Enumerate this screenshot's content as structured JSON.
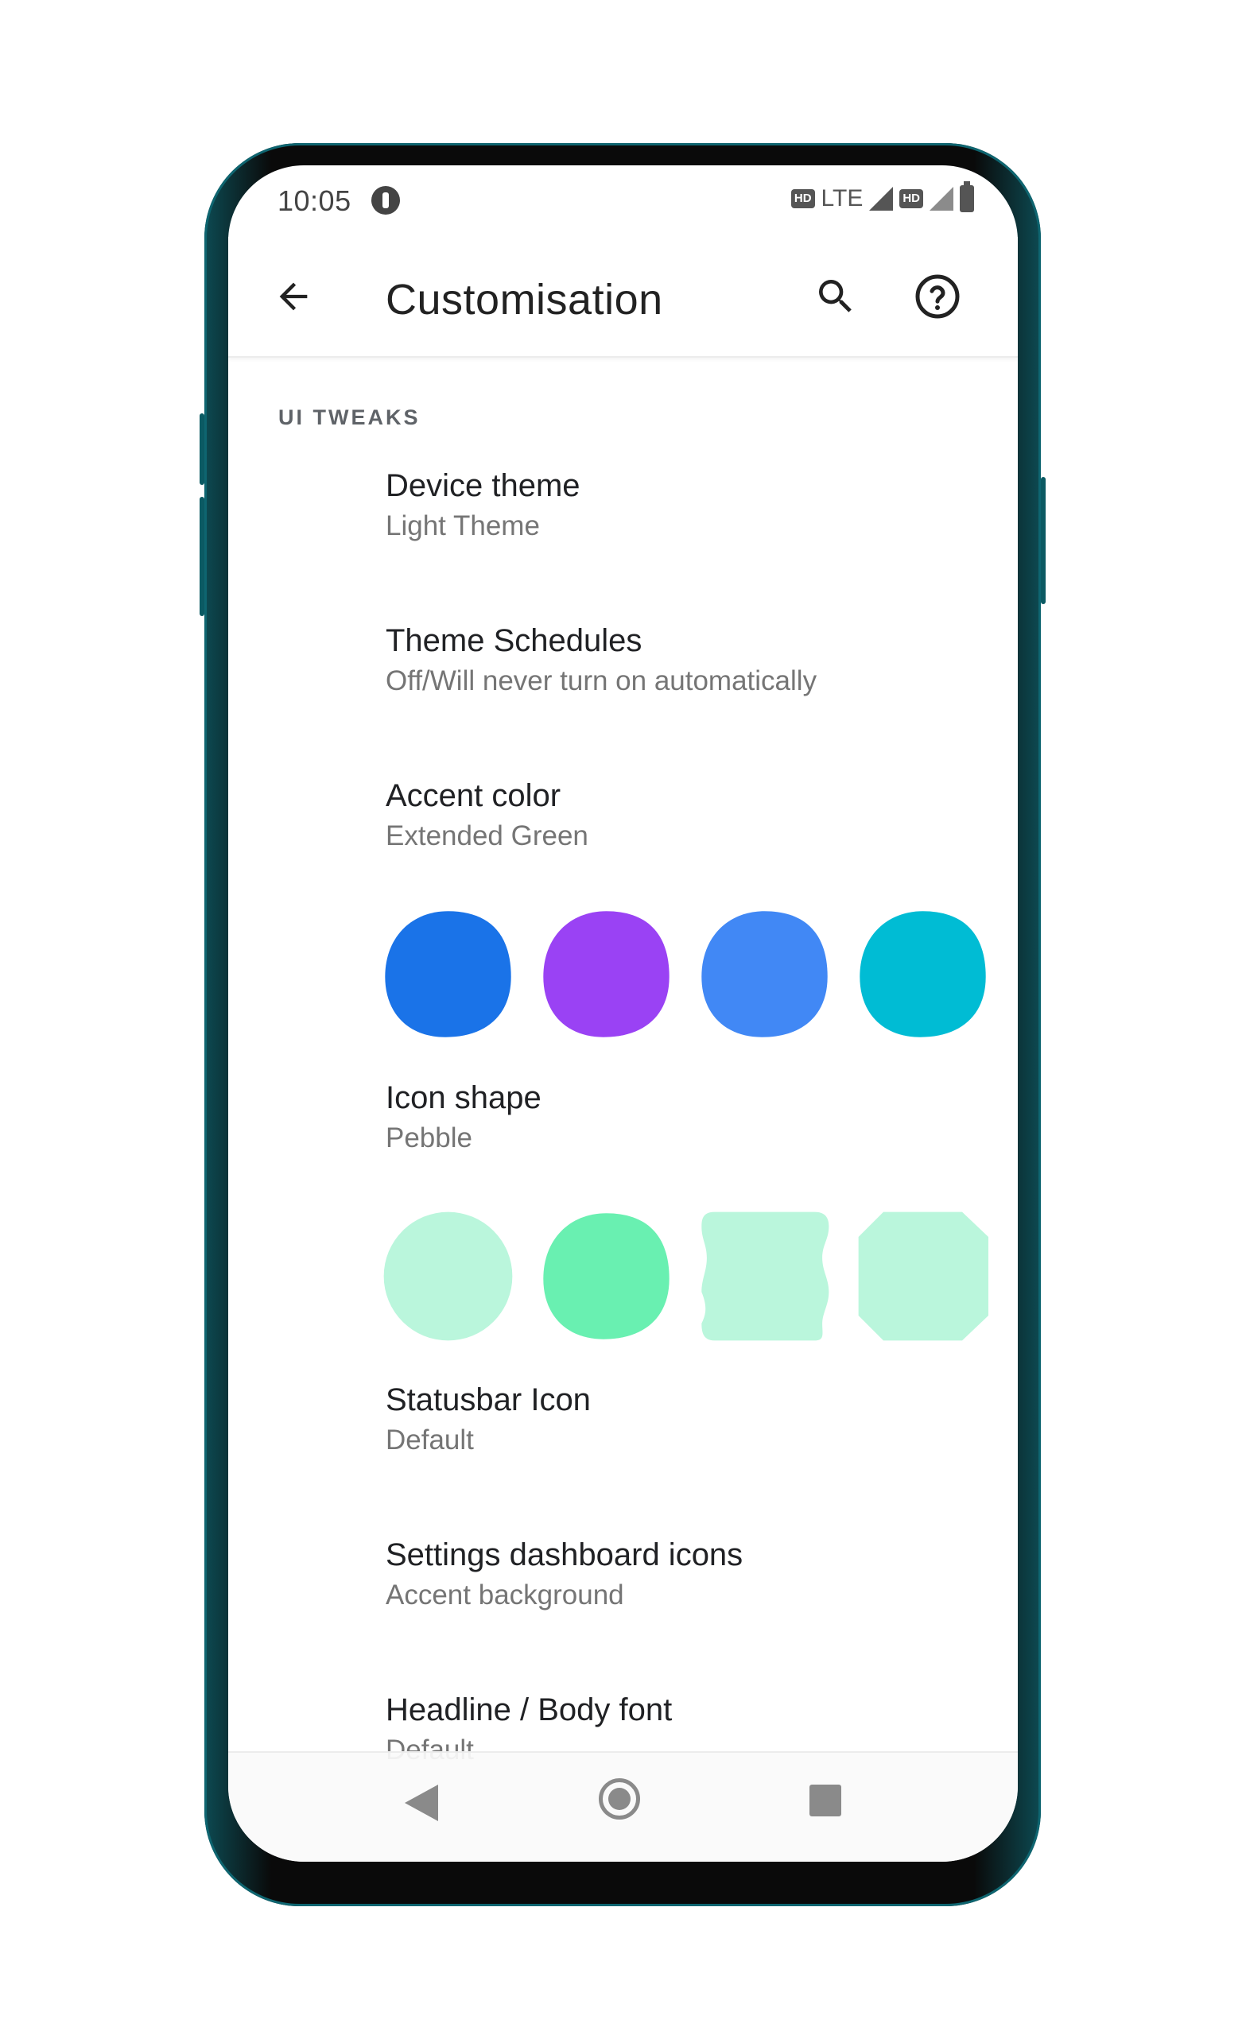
{
  "status_bar": {
    "time": "10:05",
    "hd_badge": "HD",
    "network": "LTE"
  },
  "app_bar": {
    "title": "Customisation",
    "back_icon": "arrow-back-icon",
    "search_icon": "search-icon",
    "help_icon": "help-circle-icon"
  },
  "section": {
    "header": "UI TWEAKS"
  },
  "preferences": {
    "device_theme": {
      "title": "Device theme",
      "summary": "Light Theme"
    },
    "theme_schedules": {
      "title": "Theme Schedules",
      "summary": "Off/Will never turn on automatically"
    },
    "accent_color": {
      "title": "Accent color",
      "summary": "Extended Green"
    },
    "icon_shape": {
      "title": "Icon shape",
      "summary": "Pebble"
    },
    "statusbar_icon": {
      "title": "Statusbar Icon",
      "summary": "Default"
    },
    "dashboard_icons": {
      "title": "Settings dashboard icons",
      "summary": "Accent background"
    },
    "fonts": {
      "title": "Headline / Body font",
      "summary": "Default"
    }
  },
  "accent_swatches": [
    {
      "name": "blue",
      "color": "#1a73e8"
    },
    {
      "name": "purple",
      "color": "#9a42f4"
    },
    {
      "name": "light-blue",
      "color": "#4188f5"
    },
    {
      "name": "cyan",
      "color": "#00bcd4"
    }
  ],
  "icon_shapes": [
    {
      "name": "circle",
      "color": "#baf6dc"
    },
    {
      "name": "pebble",
      "color": "#69f0b1"
    },
    {
      "name": "wavy",
      "color": "#baf6dc"
    },
    {
      "name": "octagon",
      "color": "#baf6dc"
    }
  ],
  "nav_bar": {
    "back_icon": "nav-back-icon",
    "home_icon": "nav-home-icon",
    "recents_icon": "nav-recents-icon"
  }
}
